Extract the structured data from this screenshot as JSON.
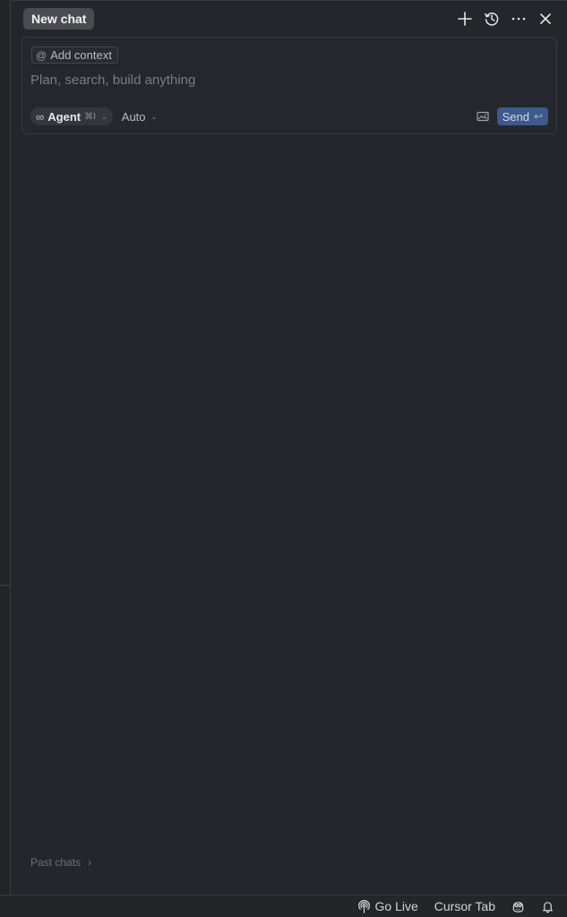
{
  "header": {
    "active_tab": "New chat",
    "actions": [
      {
        "name": "new-chat-plus-icon"
      },
      {
        "name": "history-icon"
      },
      {
        "name": "more-options-icon"
      },
      {
        "name": "close-icon"
      }
    ]
  },
  "composer": {
    "context_chip": {
      "symbol": "@",
      "label": "Add context"
    },
    "placeholder": "Plan, search, build anything",
    "mode": {
      "icon": "∞",
      "label": "Agent",
      "shortcut": "⌘I"
    },
    "model": {
      "label": "Auto"
    },
    "send": {
      "label": "Send",
      "enter_symbol": "↩"
    }
  },
  "past_chats": {
    "label": "Past chats",
    "chevron": "›"
  },
  "status_bar": {
    "go_live": "Go Live",
    "cursor_tab": "Cursor Tab"
  },
  "colors": {
    "background": "#25262b",
    "send_button": "#3d5a8a",
    "tab_active": "#4a4b50"
  }
}
